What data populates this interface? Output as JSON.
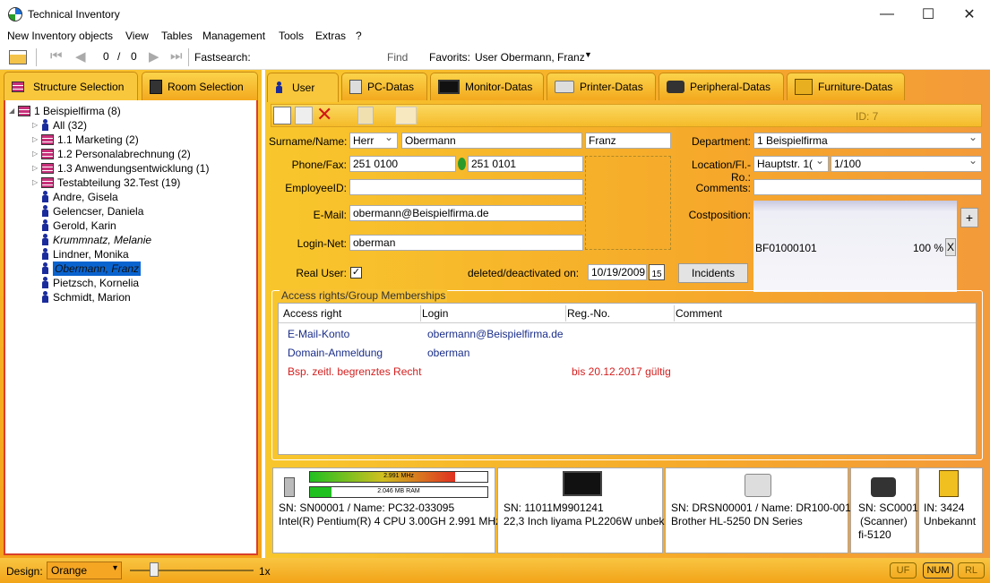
{
  "window": {
    "title": "Technical Inventory",
    "minimize": "—",
    "maximize": "☐",
    "close": "✕"
  },
  "menu": {
    "items": [
      "New Inventory objects",
      "View",
      "Tables",
      "Management",
      "Tools",
      "Extras",
      "?"
    ]
  },
  "toolbar": {
    "record_pos": "0",
    "record_sep": "/",
    "record_total": "0",
    "fastsearch_label": "Fastsearch:",
    "find_label": "Find",
    "favorites_label": "Favorits:",
    "favorites_value": "User Obermann, Franz"
  },
  "left_tabs": {
    "structure": "Structure Selection",
    "room": "Room Selection"
  },
  "tree": [
    {
      "label": "1 Beispielfirma (8)",
      "type": "dept",
      "indent": 0,
      "expanded": true
    },
    {
      "label": "All (32)",
      "type": "group",
      "indent": 1
    },
    {
      "label": "1.1 Marketing (2)",
      "type": "dept",
      "indent": 1
    },
    {
      "label": "1.2 Personalabrechnung (2)",
      "type": "dept",
      "indent": 1
    },
    {
      "label": "1.3 Anwendungsentwicklung (1)",
      "type": "dept",
      "indent": 1
    },
    {
      "label": "Testabteilung 32.Test (19)",
      "type": "dept",
      "indent": 1
    },
    {
      "label": "Andre, Gisela",
      "type": "person",
      "indent": 1
    },
    {
      "label": "Gelencser, Daniela",
      "type": "person",
      "indent": 1
    },
    {
      "label": "Gerold, Karin",
      "type": "person",
      "indent": 1
    },
    {
      "label": "Krummnatz, Melanie",
      "type": "person",
      "indent": 1,
      "italic": true
    },
    {
      "label": "Lindner, Monika",
      "type": "person",
      "indent": 1
    },
    {
      "label": "Obermann, Franz",
      "type": "person",
      "indent": 1,
      "italic": true,
      "selected": true
    },
    {
      "label": "Pietzsch, Kornelia",
      "type": "person",
      "indent": 1
    },
    {
      "label": "Schmidt, Marion",
      "type": "person",
      "indent": 1
    }
  ],
  "tabs": [
    "User",
    "PC-Datas",
    "Monitor-Datas",
    "Printer-Datas",
    "Peripheral-Datas",
    "Furniture-Datas"
  ],
  "record_id": "ID: 7",
  "form": {
    "surname_label": "Surname/Name:",
    "salutation": "Herr",
    "surname": "Obermann",
    "firstname": "Franz",
    "phone_label": "Phone/Fax:",
    "phone": "251 0100",
    "fax": "251 0101",
    "employee_label": "EmployeeID:",
    "employee": "",
    "email_label": "E-Mail:",
    "email": "obermann@Beispielfirma.de",
    "login_label": "Login-Net:",
    "login": "oberman",
    "realuser_label": "Real User:",
    "realuser_check": "✓",
    "deleted_label": "deleted/deactivated on:",
    "deleted_date": "10/19/2009",
    "date_icon": "15",
    "incidents_btn": "Incidents",
    "department_label": "Department:",
    "department": "1 Beispielfirma",
    "location_label": "Location/Fl.-Ro.:",
    "location": "Hauptstr. 1(",
    "room": "1/100",
    "comments_label": "Comments:",
    "comments": "",
    "costposition_label": "Costposition:",
    "cost_code": "BF01000101",
    "cost_percent": "100 %",
    "cost_remove": "X",
    "cost_add": "+"
  },
  "access": {
    "title": "Access rights/Group Memberships",
    "headers": [
      "Access right",
      "Login",
      "Reg.-No.",
      "Comment"
    ],
    "rows": [
      {
        "right": "E-Mail-Konto",
        "login": "obermann@Beispielfirma.de",
        "regno": "",
        "color": "#1a2e8a"
      },
      {
        "right": "Domain-Anmeldung",
        "login": "oberman",
        "regno": "",
        "color": "#1a2e8a"
      },
      {
        "right": "Bsp. zeitl. begrenztes Recht",
        "login": "",
        "regno": "bis 20.12.2017 gültig",
        "color": "#d42020"
      }
    ]
  },
  "devices": {
    "pc": {
      "cpu_bar": "2.991 MHz",
      "cpu_fill": 0.82,
      "ram_bar": "2.046 MB RAM",
      "ram_fill": 0.12,
      "line1": "SN: SN00001 / Name: PC32-033095",
      "line2": "Intel(R) Pentium(R) 4 CPU 3.00GH 2.991 MHz"
    },
    "monitor": {
      "line1": "SN: 11011M9901241",
      "line2": "22,3 Inch liyama PL2206W unbek"
    },
    "printer": {
      "line1": "SN: DRSN00001 / Name: DR100-001",
      "line2": "Brother HL-5250 DN Series"
    },
    "peripheral": {
      "line1": "SN: SC0001",
      "line2": "(Scanner)",
      "line3": "fi-5120"
    },
    "furniture": {
      "line1": "IN: 3424",
      "line2": "Unbekannt"
    }
  },
  "status": {
    "design_label": "Design:",
    "design_value": "Orange",
    "zoom": "1x",
    "uf": "UF",
    "num": "NUM",
    "rl": "RL"
  }
}
